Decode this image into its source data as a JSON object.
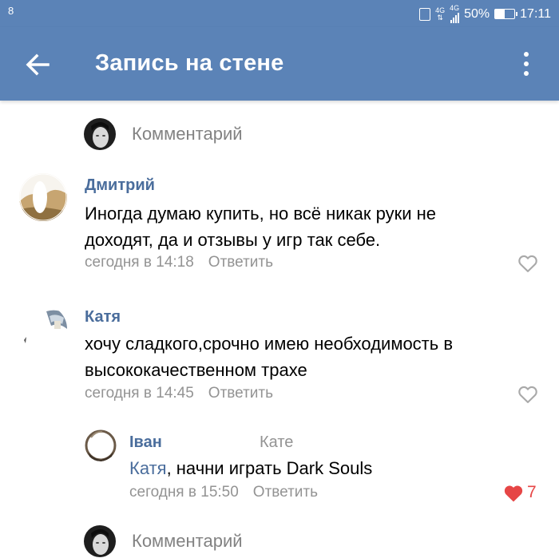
{
  "status_bar": {
    "notification": "8",
    "network_top": "4G",
    "network_bottom": "4G",
    "battery_percent": "50%",
    "battery_level": 0.5,
    "time": "17:11"
  },
  "app_bar": {
    "title": "Запись на стене",
    "back_icon": "arrow-left-icon",
    "menu_icon": "more-vertical-icon"
  },
  "composer": {
    "placeholder": "Комментарий"
  },
  "comments": [
    {
      "author": "Дмитрий",
      "text_line1": "Иногда думаю купить, но всё никак руки не",
      "text_line2": "доходят, да и отзывы у игр так себе.",
      "time": "сегодня в 14:18",
      "reply_label": "Ответить",
      "liked": false
    },
    {
      "author": "Катя",
      "text_line1": "хочу сладкого,срочно имею необходимость в",
      "text_line2": "высококачественном трахе",
      "time": "сегодня в 14:45",
      "reply_label": "Ответить",
      "liked": false
    }
  ],
  "reply": {
    "author": "Іван",
    "reply_to": "Кате",
    "mention": "Катя",
    "text": ", начни играть Dark Souls",
    "time": "сегодня в 15:50",
    "reply_label": "Ответить",
    "liked": true,
    "likes": "7"
  },
  "composer_bottom": {
    "placeholder": "Комментарий"
  },
  "colors": {
    "header": "#5b83b7",
    "author": "#4a6d9c",
    "meta": "#939393",
    "like": "#e64646"
  }
}
